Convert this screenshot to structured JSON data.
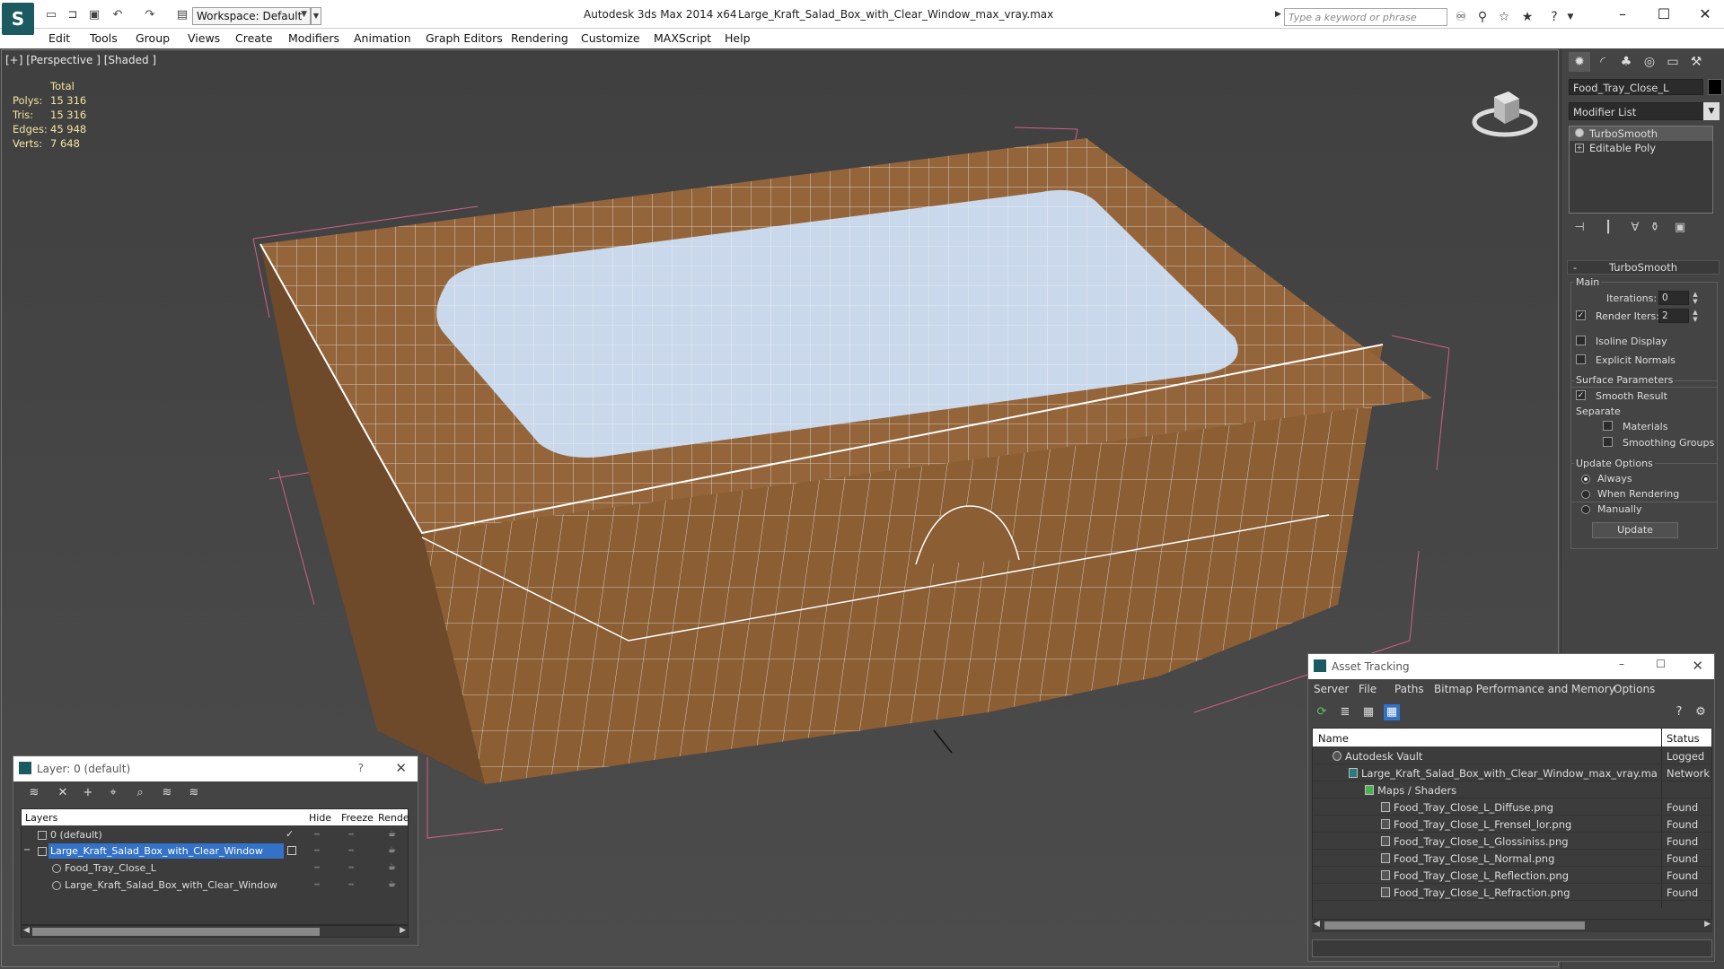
{
  "titlebar": {
    "app_title": "Autodesk 3ds Max  2014 x64",
    "file_title": "Large_Kraft_Salad_Box_with_Clear_Window_max_vray.max",
    "workspace": "Workspace: Default",
    "search_placeholder": "Type a keyword or phrase"
  },
  "menu": [
    "Edit",
    "Tools",
    "Group",
    "Views",
    "Create",
    "Modifiers",
    "Animation",
    "Graph Editors",
    "Rendering",
    "Customize",
    "MAXScript",
    "Help"
  ],
  "viewport": {
    "label": "[+] [Perspective ] [Shaded ]",
    "stats": {
      "total_label": "Total",
      "polys_label": "Polys:",
      "polys": "15 316",
      "tris_label": "Tris:",
      "tris": "15 316",
      "edges_label": "Edges:",
      "edges": "45 948",
      "verts_label": "Verts:",
      "verts": "7 648"
    }
  },
  "command_panel": {
    "object_name": "Food_Tray_Close_L",
    "modifier_list": "Modifier List",
    "stack": [
      "TurboSmooth",
      "Editable Poly"
    ],
    "rollout_title": "TurboSmooth",
    "main_group": "Main",
    "iterations_label": "Iterations:",
    "iterations_value": "0",
    "render_iters_label": "Render Iters:",
    "render_iters_value": "2",
    "isoline_label": "Isoline Display",
    "explicit_normals_label": "Explicit Normals",
    "surface_group": "Surface Parameters",
    "smooth_result_label": "Smooth Result",
    "separate_label": "Separate",
    "materials_label": "Materials",
    "smoothing_groups_label": "Smoothing Groups",
    "update_group": "Update Options",
    "always_label": "Always",
    "when_rendering_label": "When Rendering",
    "manually_label": "Manually",
    "update_button": "Update"
  },
  "layer_dialog": {
    "title": "Layer: 0 (default)",
    "help": "?",
    "columns": {
      "layers": "Layers",
      "hide": "Hide",
      "freeze": "Freeze",
      "render": "Render"
    },
    "rows": [
      {
        "name": "0 (default)"
      },
      {
        "name": "Large_Kraft_Salad_Box_with_Clear_Window"
      },
      {
        "name": "Food_Tray_Close_L"
      },
      {
        "name": "Large_Kraft_Salad_Box_with_Clear_Window"
      }
    ]
  },
  "asset_dialog": {
    "title": "Asset Tracking",
    "menu": [
      "Server",
      "File",
      "Paths",
      "Bitmap Performance and Memory",
      "Options"
    ],
    "columns": {
      "name": "Name",
      "status": "Status"
    },
    "rows": [
      {
        "name": "Autodesk Vault",
        "status": "Logged"
      },
      {
        "name": "Large_Kraft_Salad_Box_with_Clear_Window_max_vray.max",
        "status": "Network"
      },
      {
        "name": "Maps / Shaders",
        "status": ""
      },
      {
        "name": "Food_Tray_Close_L_Diffuse.png",
        "status": "Found"
      },
      {
        "name": "Food_Tray_Close_L_Frensel_lor.png",
        "status": "Found"
      },
      {
        "name": "Food_Tray_Close_L_Glossiniss.png",
        "status": "Found"
      },
      {
        "name": "Food_Tray_Close_L_Normal.png",
        "status": "Found"
      },
      {
        "name": "Food_Tray_Close_L_Reflection.png",
        "status": "Found"
      },
      {
        "name": "Food_Tray_Close_L_Refraction.png",
        "status": "Found"
      }
    ]
  },
  "colors": {
    "kraft": "#8b5e34",
    "window": "#c9d8ea",
    "selection": "#3372c7",
    "stats": "#f2e6a0"
  }
}
